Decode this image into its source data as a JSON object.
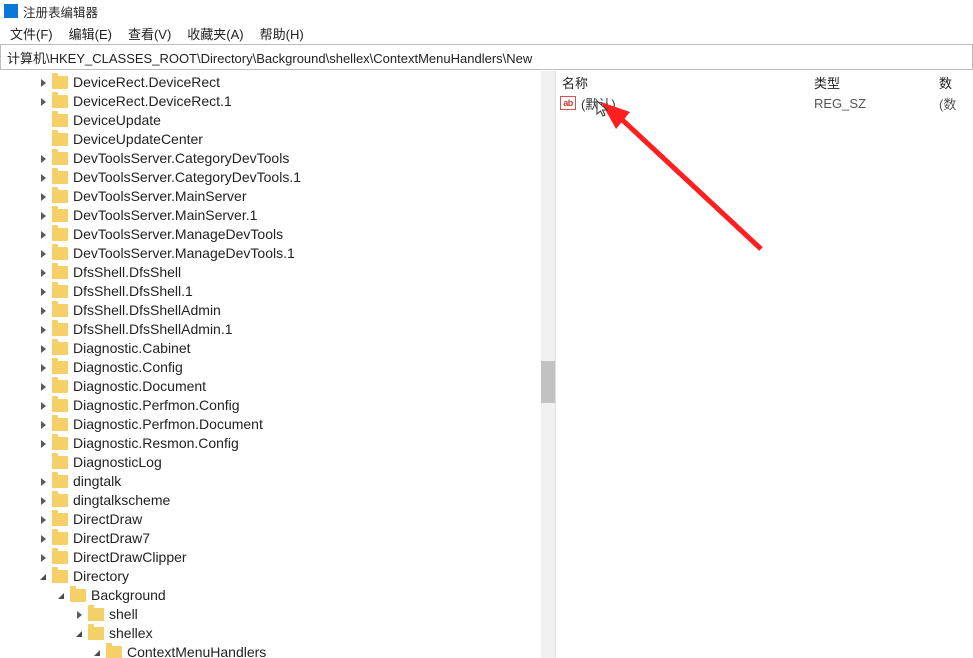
{
  "titlebar": {
    "title": "注册表编辑器"
  },
  "menubar": {
    "items": {
      "0": "文件(F)",
      "1": "编辑(E)",
      "2": "查看(V)",
      "3": "收藏夹(A)",
      "4": "帮助(H)"
    }
  },
  "path": "计算机\\HKEY_CLASSES_ROOT\\Directory\\Background\\shellex\\ContextMenuHandlers\\New",
  "tree": {
    "base_indent": 36,
    "items": [
      {
        "exp": "closed",
        "label": "DeviceRect.DeviceRect"
      },
      {
        "exp": "closed",
        "label": "DeviceRect.DeviceRect.1"
      },
      {
        "exp": "none",
        "label": "DeviceUpdate"
      },
      {
        "exp": "none",
        "label": "DeviceUpdateCenter"
      },
      {
        "exp": "closed",
        "label": "DevToolsServer.CategoryDevTools"
      },
      {
        "exp": "closed",
        "label": "DevToolsServer.CategoryDevTools.1"
      },
      {
        "exp": "closed",
        "label": "DevToolsServer.MainServer"
      },
      {
        "exp": "closed",
        "label": "DevToolsServer.MainServer.1"
      },
      {
        "exp": "closed",
        "label": "DevToolsServer.ManageDevTools"
      },
      {
        "exp": "closed",
        "label": "DevToolsServer.ManageDevTools.1"
      },
      {
        "exp": "closed",
        "label": "DfsShell.DfsShell"
      },
      {
        "exp": "closed",
        "label": "DfsShell.DfsShell.1"
      },
      {
        "exp": "closed",
        "label": "DfsShell.DfsShellAdmin"
      },
      {
        "exp": "closed",
        "label": "DfsShell.DfsShellAdmin.1"
      },
      {
        "exp": "closed",
        "label": "Diagnostic.Cabinet"
      },
      {
        "exp": "closed",
        "label": "Diagnostic.Config"
      },
      {
        "exp": "closed",
        "label": "Diagnostic.Document"
      },
      {
        "exp": "closed",
        "label": "Diagnostic.Perfmon.Config"
      },
      {
        "exp": "closed",
        "label": "Diagnostic.Perfmon.Document"
      },
      {
        "exp": "closed",
        "label": "Diagnostic.Resmon.Config"
      },
      {
        "exp": "none",
        "label": "DiagnosticLog"
      },
      {
        "exp": "closed",
        "label": "dingtalk"
      },
      {
        "exp": "closed",
        "label": "dingtalkscheme"
      },
      {
        "exp": "closed",
        "label": "DirectDraw"
      },
      {
        "exp": "closed",
        "label": "DirectDraw7"
      },
      {
        "exp": "closed",
        "label": "DirectDrawClipper"
      },
      {
        "exp": "open",
        "label": "Directory"
      },
      {
        "exp": "open",
        "label": "Background",
        "indent": 1
      },
      {
        "exp": "closed",
        "label": "shell",
        "indent": 2
      },
      {
        "exp": "open",
        "label": "shellex",
        "indent": 2
      },
      {
        "exp": "open",
        "label": "ContextMenuHandlers",
        "indent": 3
      }
    ]
  },
  "cols": {
    "name": "名称",
    "type": "类型",
    "data": "数"
  },
  "value_row": {
    "icon_text": "ab",
    "name": "(默认)",
    "type": "REG_SZ",
    "data": "(数"
  }
}
